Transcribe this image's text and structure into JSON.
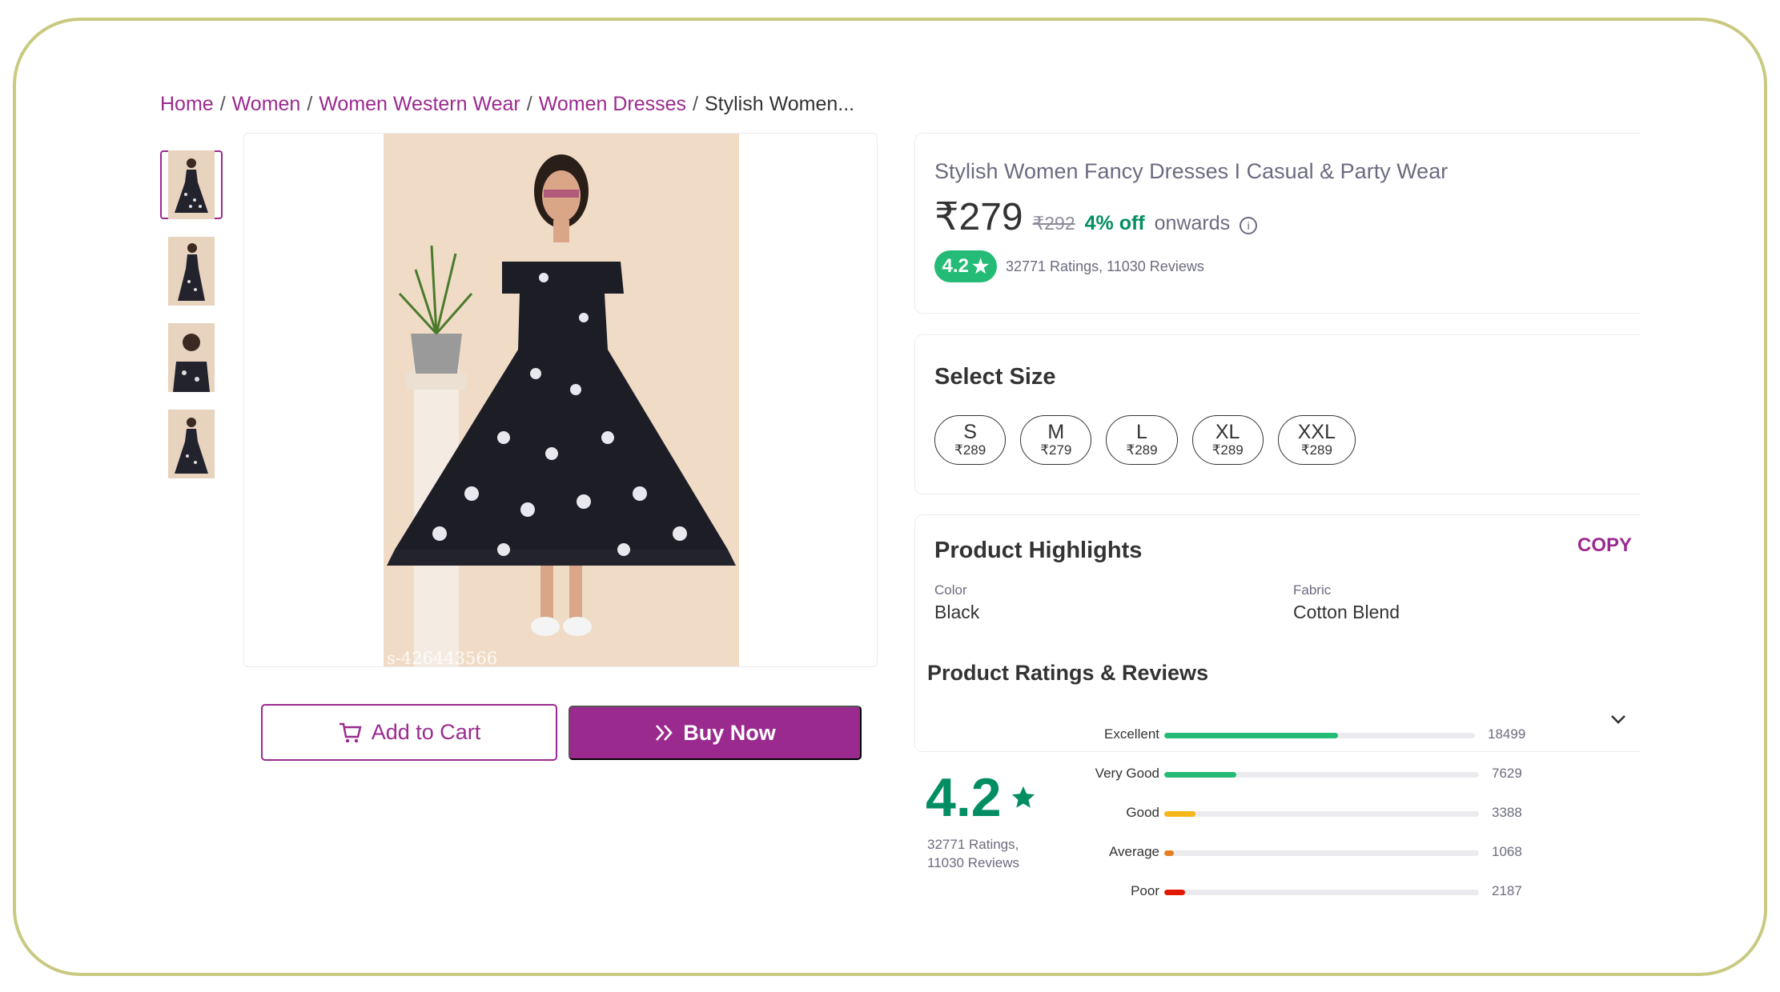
{
  "breadcrumb": {
    "items": [
      "Home",
      "Women",
      "Women Western Wear",
      "Women Dresses"
    ],
    "current": "Stylish Women..."
  },
  "gallery": {
    "thumbnail_count": 4,
    "watermark": "s-426443566"
  },
  "actions": {
    "add_to_cart": "Add to Cart",
    "buy_now": "Buy Now"
  },
  "product": {
    "title": "Stylish Women Fancy Dresses I Casual & Party Wear",
    "price": "₹279",
    "old_price": "₹292",
    "discount": "4% off",
    "onwards": "onwards",
    "rating": "4.2",
    "ratings_text": "32771 Ratings, 11030 Reviews"
  },
  "sizes": {
    "heading": "Select Size",
    "options": [
      {
        "size": "S",
        "price": "₹289"
      },
      {
        "size": "M",
        "price": "₹279"
      },
      {
        "size": "L",
        "price": "₹289"
      },
      {
        "size": "XL",
        "price": "₹289"
      },
      {
        "size": "XXL",
        "price": "₹289"
      }
    ]
  },
  "highlights": {
    "heading": "Product Highlights",
    "copy_label": "COPY",
    "color_label": "Color",
    "color_value": "Black",
    "fabric_label": "Fabric",
    "fabric_value": "Cotton Blend"
  },
  "reviews": {
    "heading": "Product Ratings & Reviews",
    "rating": "4.2",
    "ratings_line": "32771 Ratings,",
    "reviews_line": "11030 Reviews",
    "breakdown": [
      {
        "label": "Excellent",
        "count": "18499",
        "fraction": 0.56,
        "color": "#23bb75"
      },
      {
        "label": "Very Good",
        "count": "7629",
        "fraction": 0.23,
        "color": "#23bb75"
      },
      {
        "label": "Good",
        "count": "3388",
        "fraction": 0.1,
        "color": "#f4b619"
      },
      {
        "label": "Average",
        "count": "1068",
        "fraction": 0.03,
        "color": "#e67e22"
      },
      {
        "label": "Poor",
        "count": "2187",
        "fraction": 0.065,
        "color": "#e11900"
      }
    ]
  },
  "colors": {
    "brand": "#9b2a8e",
    "rating_green": "#23bb75",
    "price_green": "#038d63"
  }
}
